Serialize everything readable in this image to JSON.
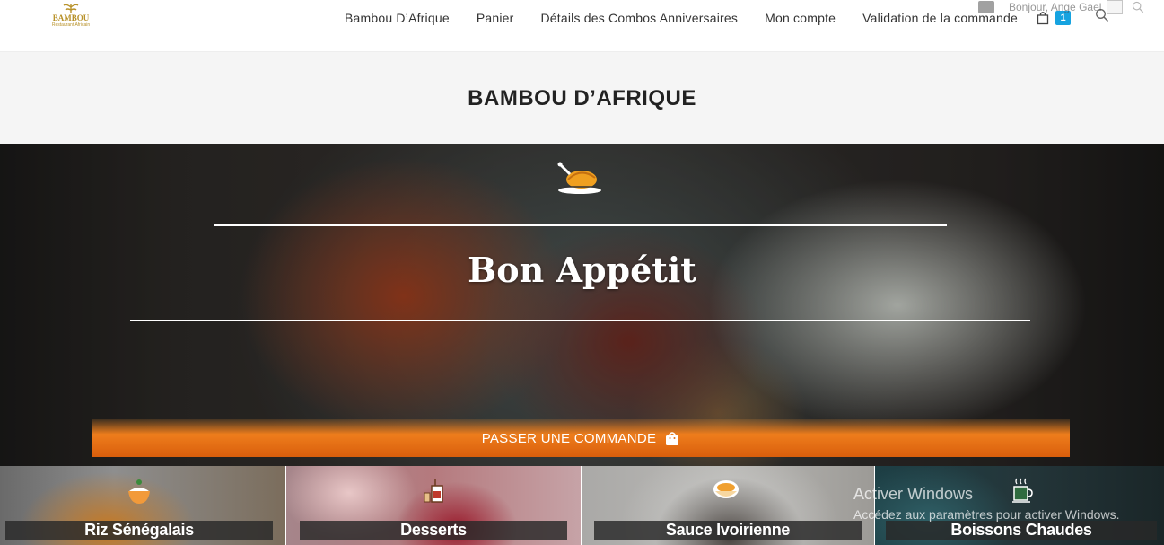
{
  "header": {
    "logo": {
      "name": "BAMBOU",
      "tagline": "Restaurant Africain",
      "icon": "bamboo-leaf-logo"
    },
    "nav": [
      {
        "label": "Bambou D’Afrique"
      },
      {
        "label": "Panier"
      },
      {
        "label": "Détails des Combos Anniversaires"
      },
      {
        "label": "Mon compte"
      },
      {
        "label": "Validation de la commande"
      }
    ],
    "cart": {
      "count": "1",
      "icon": "shopping-bag-icon"
    },
    "search_icon": "search-icon",
    "account_bar": {
      "greeting": "Bonjour, Ange Gael",
      "icons": [
        "comment-icon",
        "avatar",
        "search-icon"
      ]
    }
  },
  "page": {
    "title": "BAMBOU D’AFRIQUE"
  },
  "hero": {
    "icon": "roast-chicken-icon",
    "slogan": "Bon Appétit",
    "cta_label": "PASSER UNE COMMANDE",
    "cta_icon": "shopping-bag-icon"
  },
  "categories": [
    {
      "label": "Riz Sénégalais",
      "icon": "rice-bowl-icon"
    },
    {
      "label": "Desserts",
      "icon": "dessert-cup-icon"
    },
    {
      "label": "Sauce Ivoirienne",
      "icon": "soup-bowl-icon"
    },
    {
      "label": "Boissons Chaudes",
      "icon": "hot-drink-icon"
    }
  ],
  "watermark": {
    "title": "Activer Windows",
    "subtitle": "Accédez aux paramètres pour activer Windows."
  },
  "colors": {
    "accent_orange": "#ee7d1c",
    "cart_badge": "#16a3e0",
    "logo_gold": "#b8922a"
  }
}
